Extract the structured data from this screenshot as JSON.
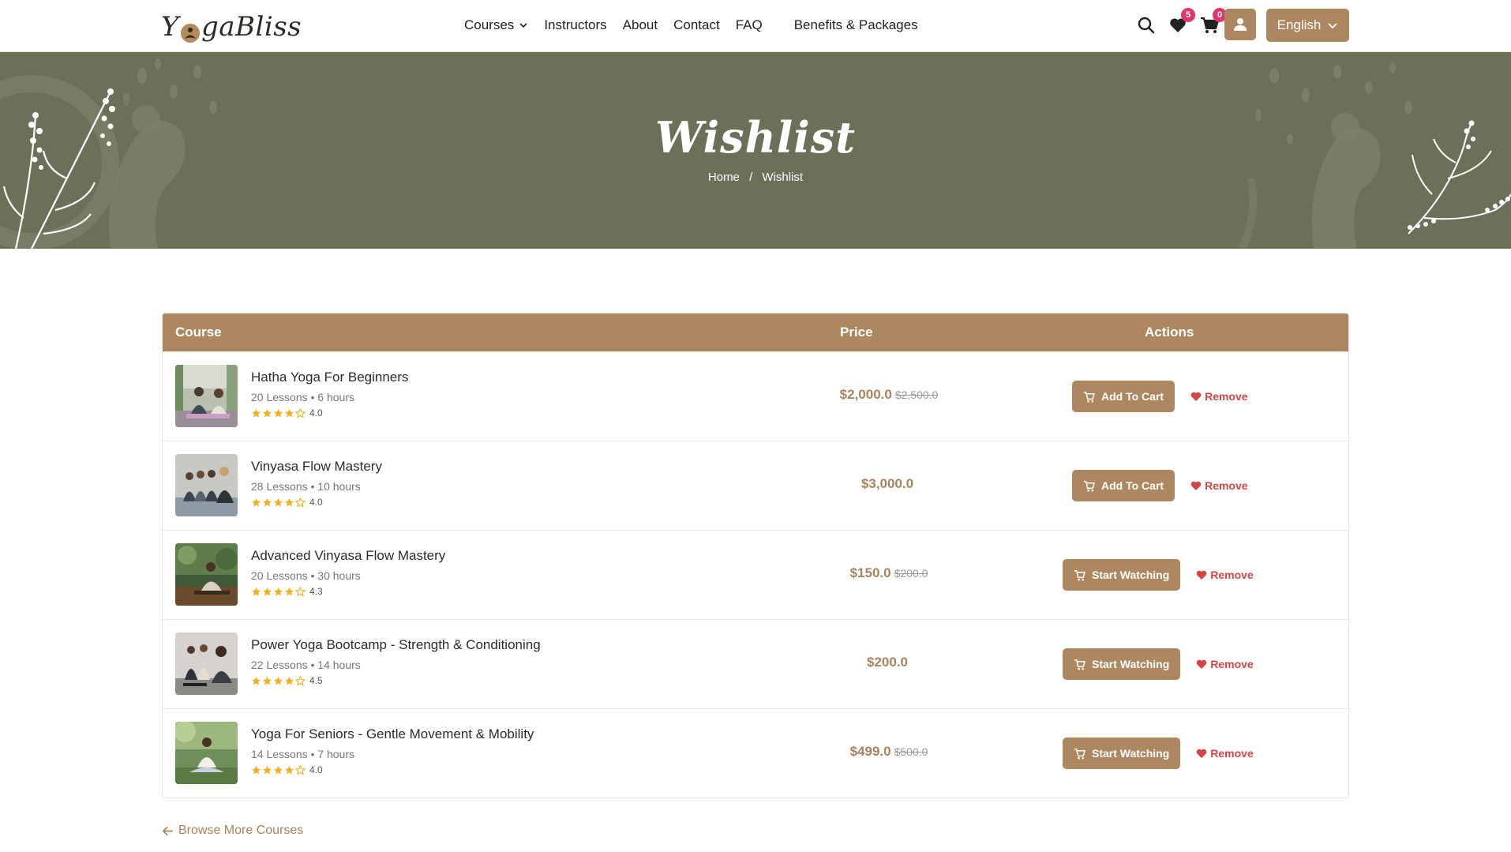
{
  "brand": {
    "logo_pre": "Y",
    "logo_post": "gaBliss",
    "accent": "#ad875f",
    "hero_bg": "#6c7059"
  },
  "nav": {
    "items": [
      "Courses",
      "Instructors",
      "About",
      "Contact",
      "FAQ",
      "Benefits & Packages"
    ]
  },
  "header": {
    "wishlist_count": "5",
    "cart_count": "0",
    "language": "English",
    "icons": [
      "search-icon",
      "heart-icon",
      "cart-icon",
      "user-icon"
    ]
  },
  "hero": {
    "title": "Wishlist",
    "breadcrumb": [
      "Home",
      "Wishlist"
    ]
  },
  "table": {
    "headers": {
      "course": "Course",
      "price": "Price",
      "actions": "Actions"
    },
    "rows": [
      {
        "title": "Hatha Yoga For Beginners",
        "meta": "20 Lessons • 6 hours",
        "rating": "4.0",
        "stars": 4,
        "price": "$2,000.0",
        "old_price": "$2,500.0",
        "action": "Add To Cart",
        "remove": "Remove"
      },
      {
        "title": "Vinyasa Flow Mastery",
        "meta": "28 Lessons • 10 hours",
        "rating": "4.0",
        "stars": 4,
        "price": "$3,000.0",
        "old_price": "",
        "action": "Add To Cart",
        "remove": "Remove"
      },
      {
        "title": "Advanced Vinyasa Flow Mastery",
        "meta": "20 Lessons • 30 hours",
        "rating": "4.3",
        "stars": 4,
        "price": "$150.0",
        "old_price": "$200.0",
        "action": "Start Watching",
        "remove": "Remove"
      },
      {
        "title": "Power Yoga Bootcamp - Strength & Conditioning",
        "meta": "22 Lessons • 14 hours",
        "rating": "4.5",
        "stars": 4,
        "price": "$200.0",
        "old_price": "",
        "action": "Start Watching",
        "remove": "Remove"
      },
      {
        "title": "Yoga For Seniors - Gentle Movement & Mobility",
        "meta": "14 Lessons • 7 hours",
        "rating": "4.0",
        "stars": 4,
        "price": "$499.0",
        "old_price": "$500.0",
        "action": "Start Watching",
        "remove": "Remove"
      }
    ]
  },
  "browse_link": "Browse More Courses"
}
